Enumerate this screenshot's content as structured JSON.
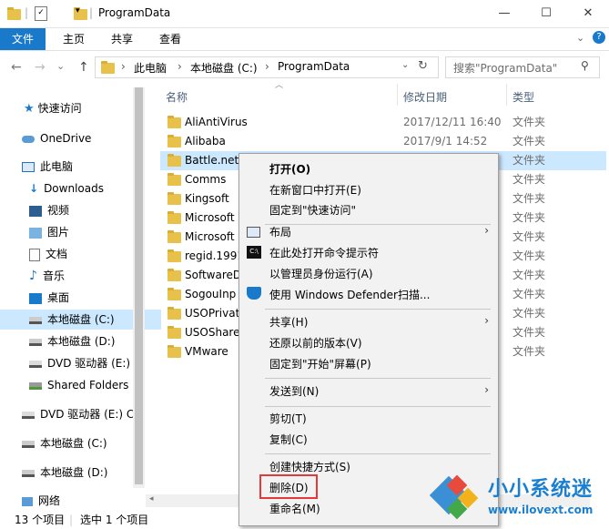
{
  "window": {
    "title": "ProgramData",
    "minimize": "—",
    "maximize": "☐",
    "close": "✕"
  },
  "ribbon": {
    "tabs": [
      "文件",
      "主页",
      "共享",
      "查看"
    ]
  },
  "nav": {
    "back": "←",
    "forward": "→",
    "recent": "⌄",
    "up": "↑",
    "path": [
      "此电脑",
      "本地磁盘 (C:)",
      "ProgramData"
    ],
    "sep": "›",
    "refresh": "↻",
    "search_placeholder": "搜索\"ProgramData\"",
    "help": "?",
    "expand": "⌄"
  },
  "sidebar": {
    "items": [
      {
        "label": "快速访问",
        "icon": "star-icon"
      },
      {
        "label": "OneDrive",
        "icon": "cloud-icon"
      },
      {
        "label": "此电脑",
        "icon": "computer-icon"
      },
      {
        "label": "Downloads",
        "icon": "download-icon"
      },
      {
        "label": "视频",
        "icon": "video-icon"
      },
      {
        "label": "图片",
        "icon": "picture-icon"
      },
      {
        "label": "文档",
        "icon": "document-icon"
      },
      {
        "label": "音乐",
        "icon": "music-icon"
      },
      {
        "label": "桌面",
        "icon": "desktop-icon"
      },
      {
        "label": "本地磁盘 (C:)",
        "icon": "drive-icon"
      },
      {
        "label": "本地磁盘 (D:)",
        "icon": "drive-icon"
      },
      {
        "label": "DVD 驱动器 (E:)",
        "icon": "dvd-icon"
      },
      {
        "label": "Shared Folders",
        "icon": "shared-folder-icon"
      },
      {
        "label": "DVD 驱动器 (E:) C",
        "icon": "dvd-icon"
      },
      {
        "label": "本地磁盘 (C:)",
        "icon": "drive-icon"
      },
      {
        "label": "本地磁盘 (D:)",
        "icon": "drive-icon"
      },
      {
        "label": "网络",
        "icon": "network-icon"
      }
    ]
  },
  "columns": {
    "name": "名称",
    "date": "修改日期",
    "type": "类型"
  },
  "files": [
    {
      "name": "AliAntiVirus",
      "date": "2017/12/11 16:40",
      "type": "文件夹"
    },
    {
      "name": "Alibaba",
      "date": "2017/9/1 14:52",
      "type": "文件夹"
    },
    {
      "name": "Battle.net",
      "date": "",
      "type": "文件夹"
    },
    {
      "name": "Comms",
      "date": "",
      "type": "文件夹"
    },
    {
      "name": "Kingsoft",
      "date": "",
      "type": "文件夹"
    },
    {
      "name": "Microsoft",
      "date": "",
      "type": "文件夹"
    },
    {
      "name": "Microsoft",
      "date": "",
      "type": "文件夹"
    },
    {
      "name": "regid.1991",
      "date": "",
      "type": "文件夹"
    },
    {
      "name": "SoftwareD",
      "date": "",
      "type": "文件夹"
    },
    {
      "name": "SogouInp",
      "date": "",
      "type": "文件夹"
    },
    {
      "name": "USOPrivat",
      "date": "",
      "type": "文件夹"
    },
    {
      "name": "USOShare",
      "date": "",
      "type": "文件夹"
    },
    {
      "name": "VMware",
      "date": "",
      "type": "文件夹"
    }
  ],
  "context_menu": {
    "items": [
      "打开(O)",
      "在新窗口中打开(E)",
      "固定到\"快速访问\"",
      "布局",
      "在此处打开命令提示符",
      "以管理员身份运行(A)",
      "使用 Windows Defender扫描...",
      "共享(H)",
      "还原以前的版本(V)",
      "固定到\"开始\"屏幕(P)",
      "发送到(N)",
      "剪切(T)",
      "复制(C)",
      "创建快捷方式(S)",
      "删除(D)",
      "重命名(M)"
    ],
    "arrow": "›"
  },
  "status": {
    "count": "13 个项目",
    "selected": "选中 1 个项目"
  },
  "watermark": {
    "brand": "小小系统迷",
    "url": "www.ilovext.com"
  },
  "colors": {
    "accent": "#1979ca",
    "selection": "#cce8ff",
    "highlight_box": "#e03a3a"
  }
}
